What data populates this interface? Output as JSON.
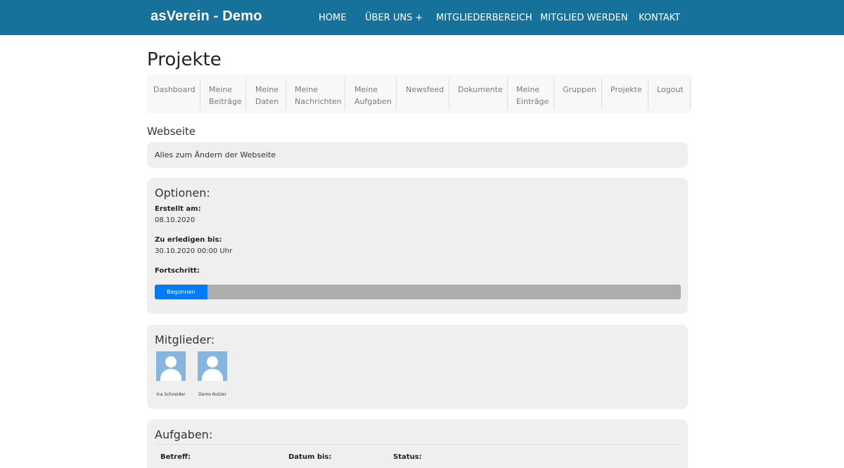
{
  "brand": "asVerein - Demo",
  "main_nav": [
    "HOME",
    "ÜBER UNS +",
    "MITGLIEDERBEREICH",
    "MITGLIED WERDEN",
    "KONTAKT"
  ],
  "page_title": "Projekte",
  "sub_nav": [
    [
      "Dashboard",
      ""
    ],
    [
      "Meine",
      "Beiträge"
    ],
    [
      "Meine",
      "Daten"
    ],
    [
      "Meine",
      "Nachrichten"
    ],
    [
      "Meine",
      "Aufgaben"
    ],
    [
      "Newsfeed",
      ""
    ],
    [
      "Dokumente",
      ""
    ],
    [
      "Meine",
      "Einträge"
    ],
    [
      "Gruppen",
      ""
    ],
    [
      "Projekte",
      ""
    ],
    [
      "Logout",
      ""
    ]
  ],
  "project": {
    "name": "Webseite",
    "description": "Alles zum Ändern der Webseite"
  },
  "options": {
    "heading": "Optionen:",
    "created_label": "Erstellt am:",
    "created_value": "08.10.2020",
    "due_label": "Zu erledigen bis:",
    "due_value": "30.10.2020 00:00 Uhr",
    "progress_label": "Fortschritt:",
    "progress_status": "Begonnen",
    "progress_fraction": 0.1,
    "progress_color": "#007bff"
  },
  "members": {
    "heading": "Mitglieder:",
    "list": [
      "Ina Schneider",
      "Demo Nutzer"
    ]
  },
  "tasks": {
    "heading": "Aufgaben:",
    "columns": [
      "Betreff:",
      "Datum bis:",
      "Status:"
    ]
  },
  "colors": {
    "header_bg": "#17729b",
    "avatar_bg": "#86b6e0",
    "card_bg": "#efefef"
  }
}
